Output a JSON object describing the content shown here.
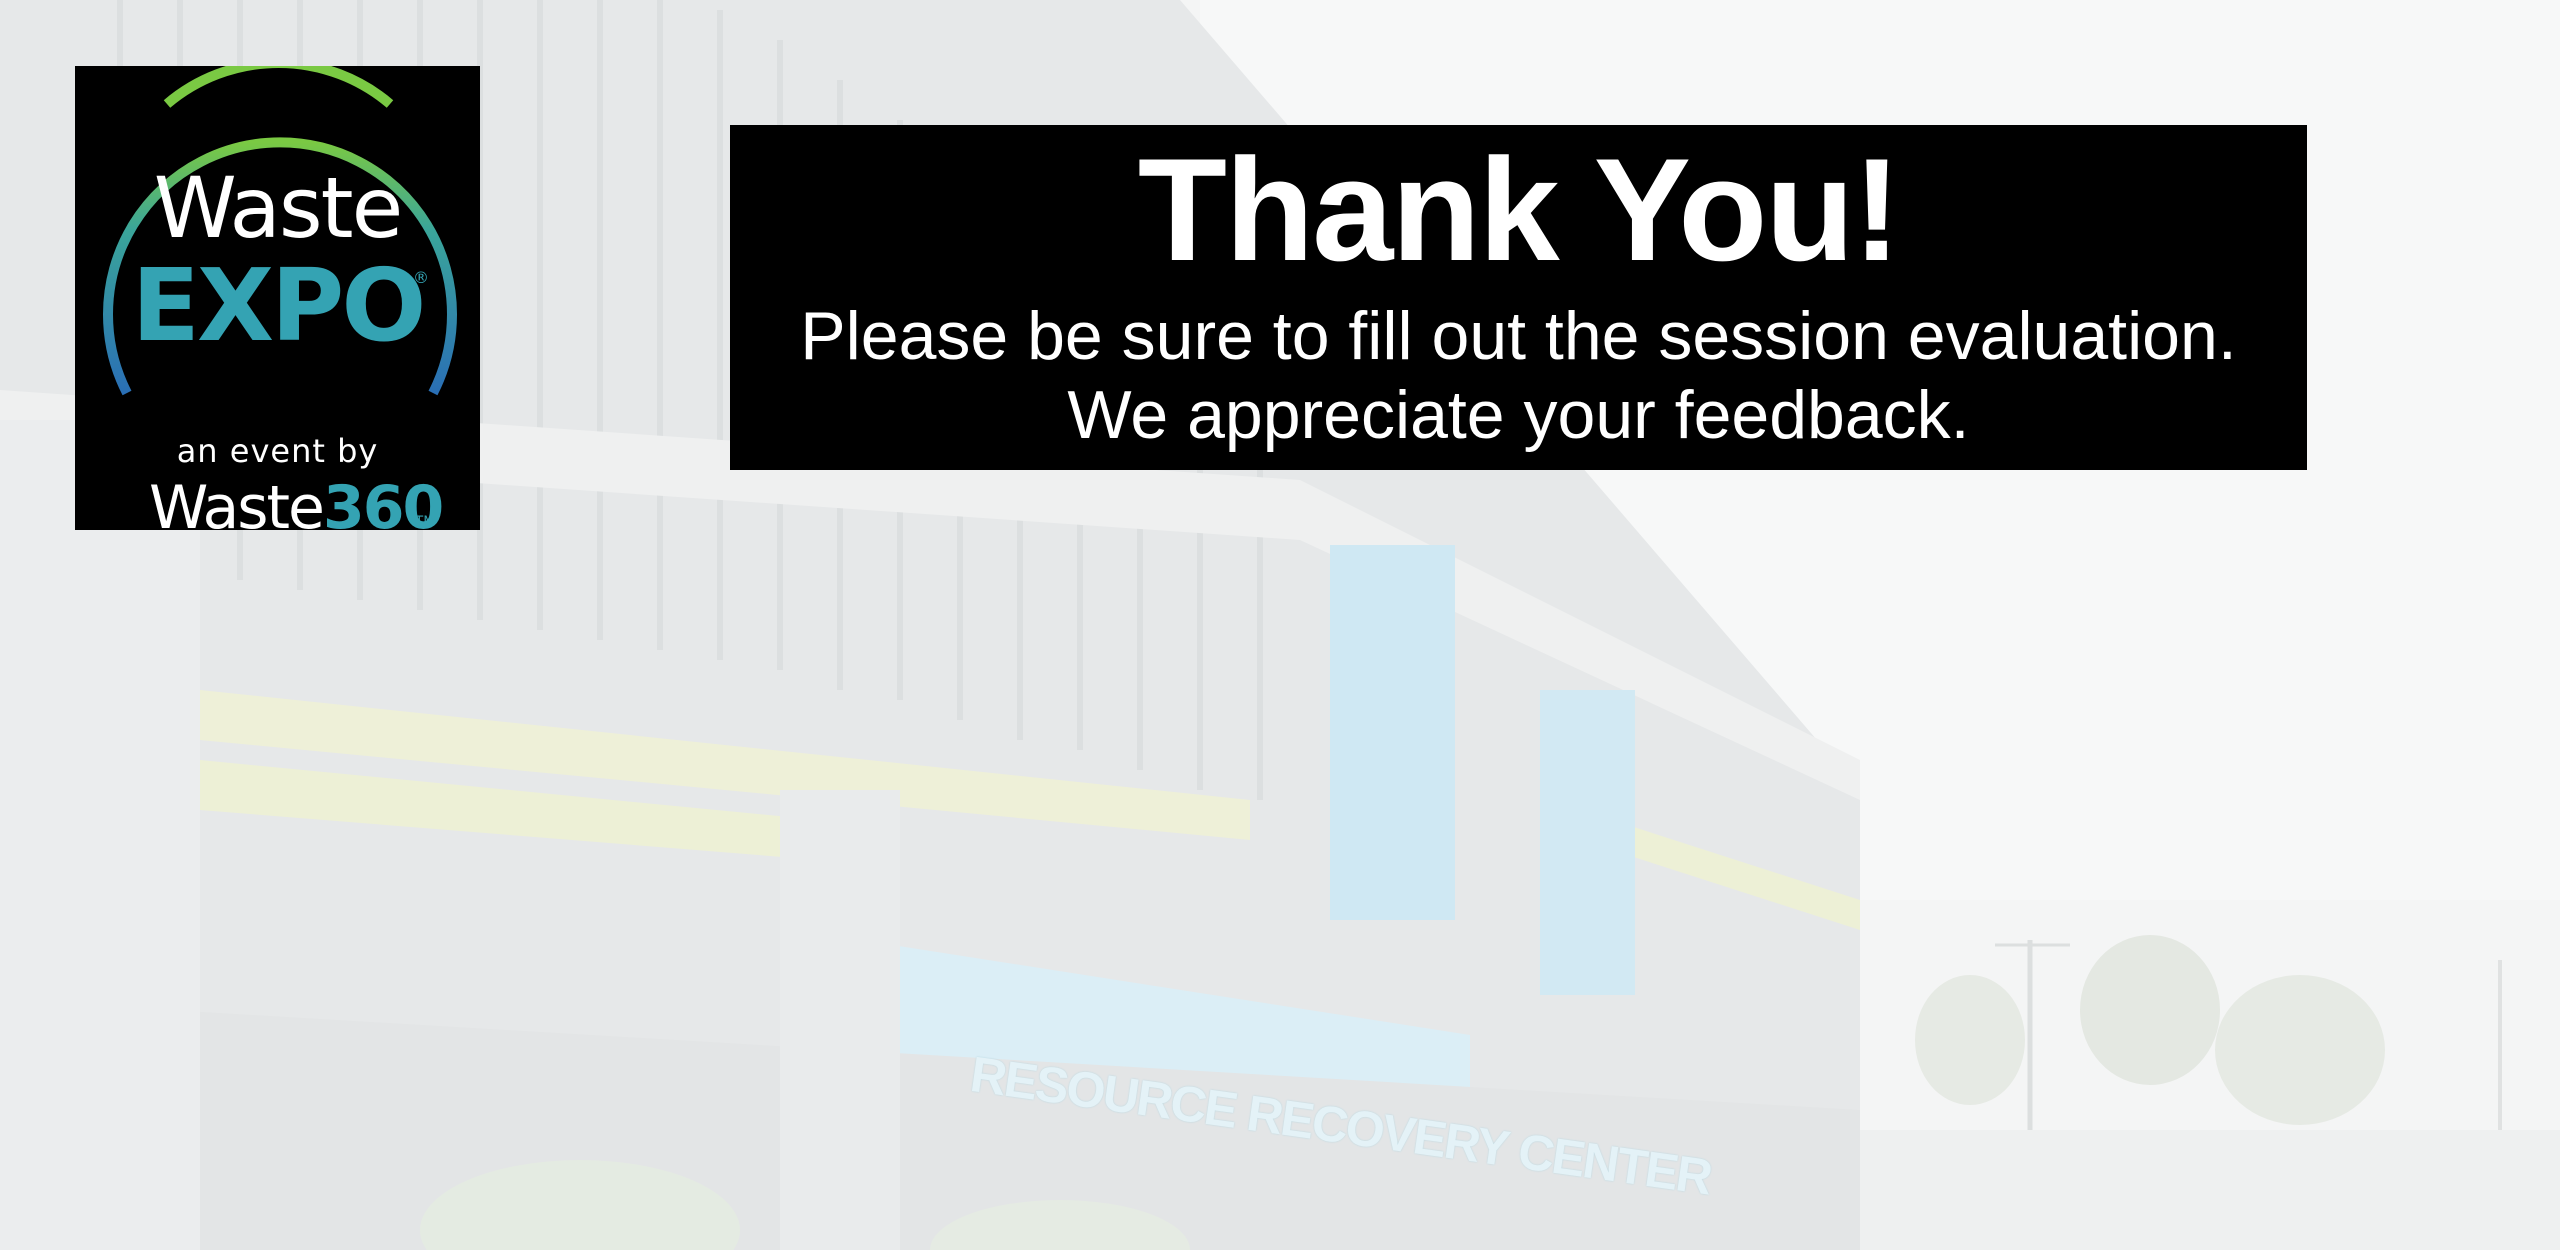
{
  "logo": {
    "line1": "Waste",
    "line2": "EXPO",
    "registered": "®",
    "tagline": "an event by",
    "brand_word": "Waste",
    "brand_number": "360",
    "trademark": "TM",
    "colors": {
      "arc_green": "#7ac943",
      "arc_teal": "#2e9fae",
      "arc_blue": "#2a6fb5",
      "text_teal": "#34a3b3"
    }
  },
  "banner": {
    "title": "Thank You!",
    "line1": "Please be sure to fill out the session evaluation.",
    "line2": "We appreciate your feedback."
  },
  "background": {
    "sign_text": "RESOURCE RECOVERY CENTER"
  }
}
